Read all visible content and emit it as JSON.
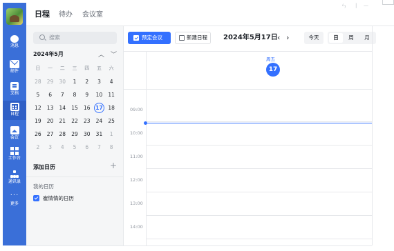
{
  "rail": {
    "items": [
      {
        "label": "消息",
        "icon": "message-icon"
      },
      {
        "label": "邮件",
        "icon": "mail-icon"
      },
      {
        "label": "文档",
        "icon": "document-icon"
      },
      {
        "label": "日程",
        "icon": "calendar-icon",
        "active": true
      },
      {
        "label": "会议",
        "icon": "meeting-icon"
      },
      {
        "label": "工作台",
        "icon": "workbench-icon"
      },
      {
        "label": "通讯录",
        "icon": "contacts-icon"
      },
      {
        "label": "更多",
        "icon": "more-icon"
      }
    ]
  },
  "topbar": {
    "tabs": [
      {
        "label": "日程",
        "active": true
      },
      {
        "label": "待办",
        "active": false
      },
      {
        "label": "会议室",
        "active": false
      }
    ],
    "window_controls": [
      "ㄣ",
      "|",
      "—"
    ]
  },
  "sidebar": {
    "search_placeholder": "搜索",
    "month_title": "2024年5月",
    "nav_prev": "^",
    "nav_next": "v",
    "weekdays": [
      "日",
      "一",
      "二",
      "三",
      "四",
      "五",
      "六"
    ],
    "weeks": [
      [
        {
          "d": "28",
          "m": true
        },
        {
          "d": "29",
          "m": true
        },
        {
          "d": "30",
          "m": true
        },
        {
          "d": "1"
        },
        {
          "d": "2"
        },
        {
          "d": "3"
        },
        {
          "d": "4"
        }
      ],
      [
        {
          "d": "5"
        },
        {
          "d": "6"
        },
        {
          "d": "7"
        },
        {
          "d": "8"
        },
        {
          "d": "9"
        },
        {
          "d": "10"
        },
        {
          "d": "11"
        }
      ],
      [
        {
          "d": "12"
        },
        {
          "d": "13"
        },
        {
          "d": "14"
        },
        {
          "d": "15"
        },
        {
          "d": "16"
        },
        {
          "d": "17",
          "t": true
        },
        {
          "d": "18"
        }
      ],
      [
        {
          "d": "19"
        },
        {
          "d": "20"
        },
        {
          "d": "21"
        },
        {
          "d": "22"
        },
        {
          "d": "23"
        },
        {
          "d": "24"
        },
        {
          "d": "25"
        }
      ],
      [
        {
          "d": "26"
        },
        {
          "d": "27"
        },
        {
          "d": "28"
        },
        {
          "d": "29"
        },
        {
          "d": "30"
        },
        {
          "d": "31"
        },
        {
          "d": "1",
          "m": true
        }
      ],
      [
        {
          "d": "2",
          "m": true
        },
        {
          "d": "3",
          "m": true
        },
        {
          "d": "4",
          "m": true
        },
        {
          "d": "5",
          "m": true
        },
        {
          "d": "6",
          "m": true
        },
        {
          "d": "7",
          "m": true
        },
        {
          "d": "8",
          "m": true
        }
      ]
    ],
    "add_calendar_label": "添加日历",
    "add_calendar_plus": "+",
    "my_calendars_label": "我的日历",
    "calendar_item_label": "崔情情的日历"
  },
  "toolbar": {
    "book_meeting_label": "预定会议",
    "new_event_label": "新建日程",
    "date_title": "2024年5月17日",
    "prev_arrow": "‹",
    "next_arrow": "›",
    "today_label": "今天",
    "views": [
      {
        "label": "日",
        "active": true
      },
      {
        "label": "周",
        "active": false
      },
      {
        "label": "月",
        "active": false
      }
    ]
  },
  "day_view": {
    "weekday": "周五",
    "day_number": "17",
    "hours": [
      "09:00",
      "10:00",
      "11:00",
      "12:00",
      "13:00",
      "14:00"
    ]
  },
  "colors": {
    "accent": "#3370ff",
    "rail": "#3a6fd8"
  }
}
